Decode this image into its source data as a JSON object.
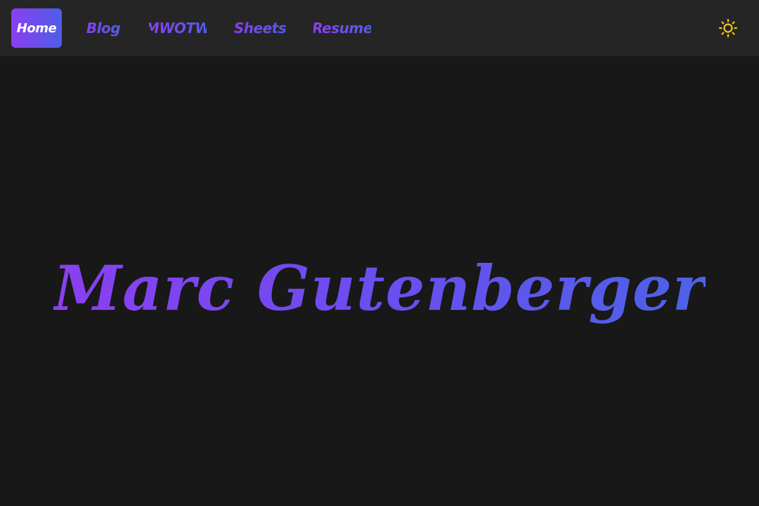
{
  "nav": {
    "items": [
      {
        "label": "Home",
        "active": true
      },
      {
        "label": "Blog",
        "active": false
      },
      {
        "label": "MWOTW",
        "active": false
      },
      {
        "label": "Sheets",
        "active": false
      },
      {
        "label": "Resume",
        "active": false
      }
    ],
    "theme_toggle_icon": "sun-icon"
  },
  "hero": {
    "title": "Marc Gutenberger"
  },
  "colors": {
    "background": "#181818",
    "navbar": "#252525",
    "gradient_start": "#8a3ff0",
    "gradient_end": "#4f5ee8",
    "sun": "#f5c518"
  }
}
